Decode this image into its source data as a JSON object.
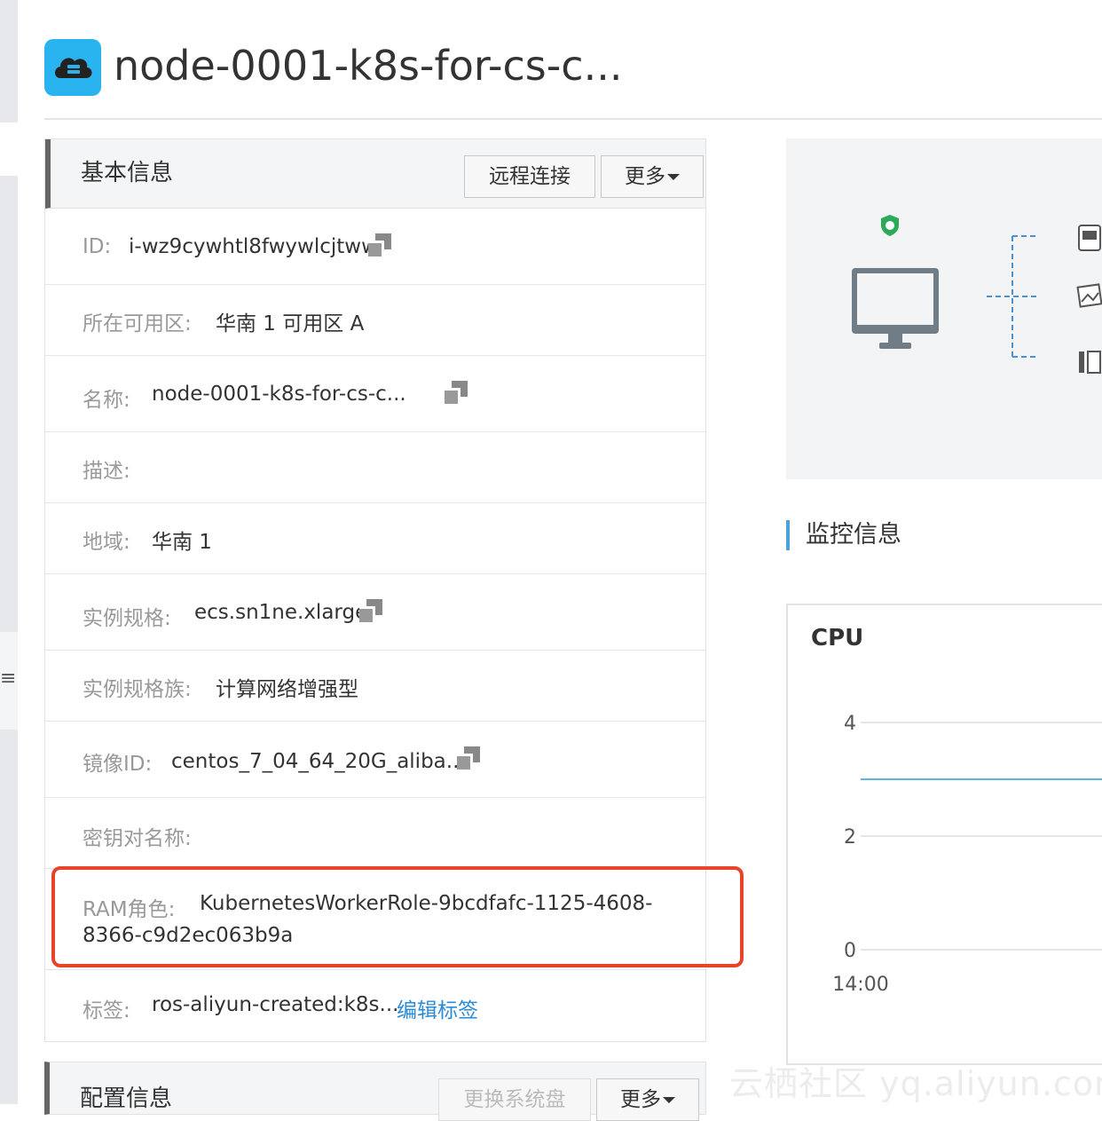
{
  "sidebar": {
    "tab_icon": "list-icon"
  },
  "header": {
    "icon": "cloud-server-icon",
    "title": "node-0001-k8s-for-cs-c..."
  },
  "basic_info": {
    "title": "基本信息",
    "remote_button": "远程连接",
    "more_button": "更多",
    "rows": [
      {
        "label": "ID:",
        "value": "i-wz9cywhtl8fwywlcjtww",
        "copy_icon": "copy-icon"
      },
      {
        "label": "所在可用区:",
        "value": "华南 1 可用区 A"
      },
      {
        "label": "名称:",
        "value": "node-0001-k8s-for-cs-c...",
        "copy_icon": "copy-icon"
      },
      {
        "label": "描述:",
        "value": ""
      },
      {
        "label": "地域:",
        "value": "华南 1"
      },
      {
        "label": "实例规格:",
        "value": "ecs.sn1ne.xlarge",
        "copy_icon": "copy-icon"
      },
      {
        "label": "实例规格族:",
        "value": "计算网络增强型"
      },
      {
        "label": "镜像ID:",
        "value": "centos_7_04_64_20G_aliba...",
        "copy_icon": "copy-icon"
      },
      {
        "label": "密钥对名称:",
        "value": ""
      },
      {
        "label": "RAM角色:",
        "value_line1": "KubernetesWorkerRole-9bcdfafc-1125-4608-",
        "value_line2": "8366-c9d2ec063b9a"
      },
      {
        "label": "标签:",
        "value": "ros-aliyun-created:k8s...",
        "link": "编辑标签"
      }
    ]
  },
  "config_info": {
    "title": "配置信息",
    "change_disk_button": "更换系统盘",
    "more_button": "更多"
  },
  "topology": {
    "icons": [
      "shield-icon",
      "monitor-icon",
      "disk-icon",
      "image-icon",
      "snapshot-icon"
    ],
    "colors": {
      "shield": "#2bab5a",
      "monitor": "#707d87",
      "connector": "#4a8fcf"
    }
  },
  "monitoring": {
    "title": "监控信息"
  },
  "chart_data": {
    "type": "line",
    "title": "CPU",
    "y_ticks": [
      "4",
      "2",
      "0"
    ],
    "x_ticks": [
      "14:00"
    ],
    "ylim": [
      0,
      4
    ],
    "series": [
      {
        "values": [
          3,
          3
        ],
        "color": "#5bb7e0"
      }
    ]
  },
  "watermark": "云栖社区 yq.aliyun.com"
}
